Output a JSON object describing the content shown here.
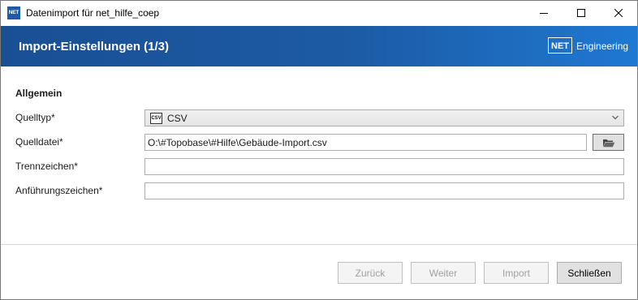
{
  "window": {
    "app_icon_text": "NET",
    "title": "Datenimport für net_hilfe_coep"
  },
  "header": {
    "title": "Import-Einstellungen (1/3)",
    "logo_box": "NET",
    "logo_text": "Engineering"
  },
  "form": {
    "section_title": "Allgemein",
    "source_type": {
      "label": "Quelltyp*",
      "icon_text": "CSV",
      "value": "CSV"
    },
    "source_file": {
      "label": "Quelldatei*",
      "value": "O:\\#Topobase\\#Hilfe\\Gebäude-Import.csv"
    },
    "separator": {
      "label": "Trennzeichen*",
      "value": ""
    },
    "quote_char": {
      "label": "Anführungszeichen*",
      "value": ""
    }
  },
  "footer": {
    "back_label": "Zurück",
    "next_label": "Weiter",
    "import_label": "Import",
    "close_label": "Schließen"
  }
}
